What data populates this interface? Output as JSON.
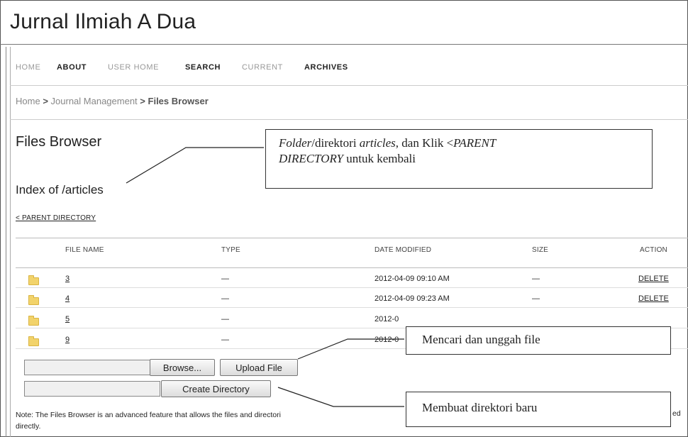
{
  "site": {
    "title": "Jurnal Ilmiah A Dua"
  },
  "nav": {
    "items": [
      {
        "label": "HOME"
      },
      {
        "label": "ABOUT"
      },
      {
        "label": "USER HOME"
      },
      {
        "label": "SEARCH"
      },
      {
        "label": "CURRENT"
      },
      {
        "label": "ARCHIVES"
      }
    ]
  },
  "breadcrumb": {
    "home": "Home",
    "sep": ">",
    "section": "Journal Management",
    "current": "Files Browser"
  },
  "page": {
    "title": "Files Browser",
    "index_heading": "Index of /articles",
    "parent_link": "< PARENT DIRECTORY"
  },
  "table": {
    "headers": {
      "file_name": "FILE NAME",
      "type": "TYPE",
      "date_modified": "DATE MODIFIED",
      "size": "SIZE",
      "action": "ACTION"
    },
    "rows": [
      {
        "name": "3",
        "type": "—",
        "date": "2012-04-09 09:10 AM",
        "size": "—",
        "action": "DELETE"
      },
      {
        "name": "4",
        "type": "—",
        "date": "2012-04-09 09:23 AM",
        "size": "—",
        "action": "DELETE"
      },
      {
        "name": "5",
        "type": "—",
        "date": "2012-0"
      },
      {
        "name": "9",
        "type": "—",
        "date": "2012-0"
      }
    ]
  },
  "upload": {
    "browse_label": "Browse...",
    "upload_label": "Upload File"
  },
  "directory": {
    "create_label": "Create Directory"
  },
  "note": {
    "text": "Note: The Files Browser is an advanced feature that allows the files and directori",
    "text_line2": "directly.",
    "tail": "ed"
  },
  "callouts": {
    "folder_info_part1": "Folder",
    "folder_info_part2": "/direktori ",
    "folder_info_part3": "articles",
    "folder_info_part4": ", dan Klik <",
    "folder_info_part5": "PARENT",
    "folder_info_line2_italic": "DIRECTORY",
    "folder_info_line2_rest": " untuk kembali",
    "upload_info": "Mencari dan unggah file",
    "mkdir_info": "Membuat direktori baru"
  },
  "icons": {
    "folder": "folder-icon"
  },
  "colors": {
    "folder": "#f2d36b"
  }
}
